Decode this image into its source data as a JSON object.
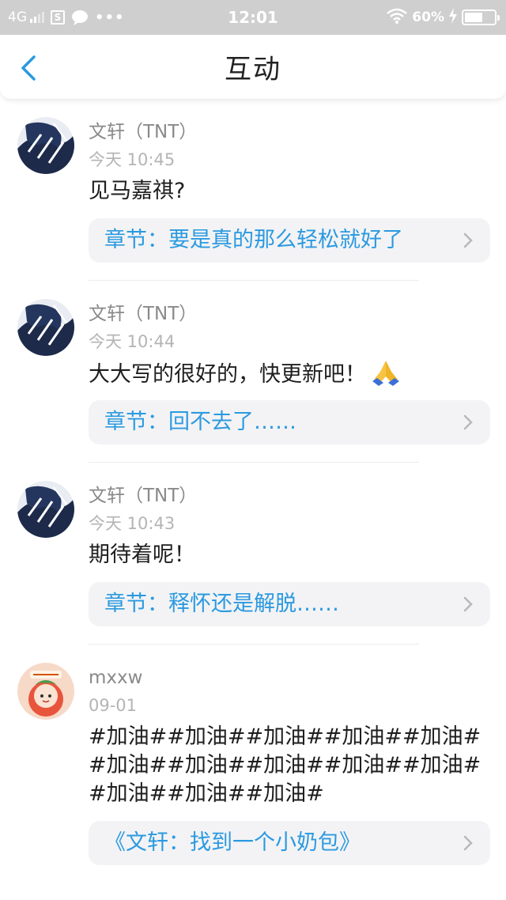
{
  "status_bar": {
    "network": "4G",
    "time": "12:01",
    "battery": "60%",
    "battery_level": 0.6
  },
  "header": {
    "title": "互动",
    "back_icon": "chevron-left-icon"
  },
  "colors": {
    "accent": "#2b9ae0",
    "status_bar_bg": "#cfcfcf",
    "chapter_bg": "#f3f3f5"
  },
  "comments": [
    {
      "username": "文轩（TNT）",
      "time": "今天 10:45",
      "text": "见马嘉祺?",
      "chapter": "章节：要是真的那么轻松就好了",
      "avatar": "ink-portrait-avatar"
    },
    {
      "username": "文轩（TNT）",
      "time": "今天 10:44",
      "text": "大大写的很好的，快更新吧！",
      "emoji": "folded-hands-emoji",
      "chapter": "章节：回不去了……",
      "avatar": "ink-portrait-avatar"
    },
    {
      "username": "文轩（TNT）",
      "time": "今天 10:43",
      "text": "期待着呢！",
      "chapter": "章节：释怀还是解脱……",
      "avatar": "ink-portrait-avatar"
    },
    {
      "username": "mxxw",
      "time": "09-01",
      "text": "#加油##加油##加油##加油##加油##加油##加油##加油##加油##加油##加油##加油##加油#",
      "chapter": "《文轩：找到一个小奶包》",
      "avatar": "cartoon-girl-avatar"
    }
  ]
}
